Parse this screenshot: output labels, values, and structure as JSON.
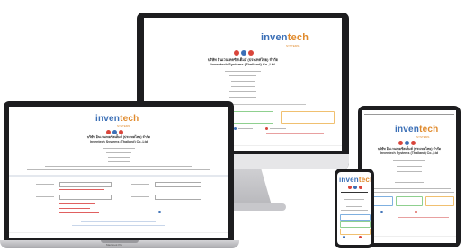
{
  "brand": {
    "logo_main": "inven",
    "logo_accent": "tech",
    "logo_sub": "SYSTEMS",
    "company_th": "บริษัท อินเวนเทคซิสเต็มส์ (ประเทศไทย) จำกัด",
    "company_en": "Inventech Systems (Thailand) Co.,Ltd",
    "colors": {
      "blue": "#3b6fb6",
      "orange": "#e08a2c",
      "red": "#d9453b",
      "green": "#4caf50"
    }
  },
  "laptop": {
    "label": "MacBook Pro"
  },
  "icons": [
    "social-circle-red-icon",
    "social-circle-blue-icon",
    "social-circle-red-icon"
  ]
}
